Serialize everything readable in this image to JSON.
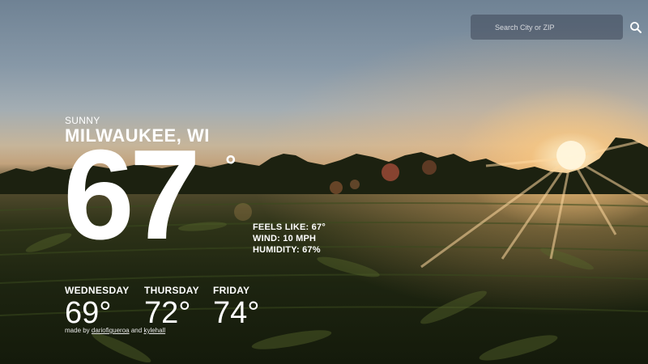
{
  "search": {
    "placeholder": "Search City or ZIP",
    "icon": "search-icon"
  },
  "current": {
    "condition": "SUNNY",
    "city": "MILWAUKEE, WI",
    "temperature": "67",
    "degree_symbol": "°",
    "feels_like": "FEELS LIKE: 67°",
    "wind": "WIND: 10 MPH",
    "humidity": "HUMIDITY: 67%"
  },
  "forecast": [
    {
      "day": "WEDNESDAY",
      "temp": "69°"
    },
    {
      "day": "THURSDAY",
      "temp": "72°"
    },
    {
      "day": "FRIDAY",
      "temp": "74°"
    }
  ],
  "credit": {
    "prefix": "made by",
    "author1": "dariofigueroa",
    "and": "and",
    "author2": "kylehall"
  }
}
